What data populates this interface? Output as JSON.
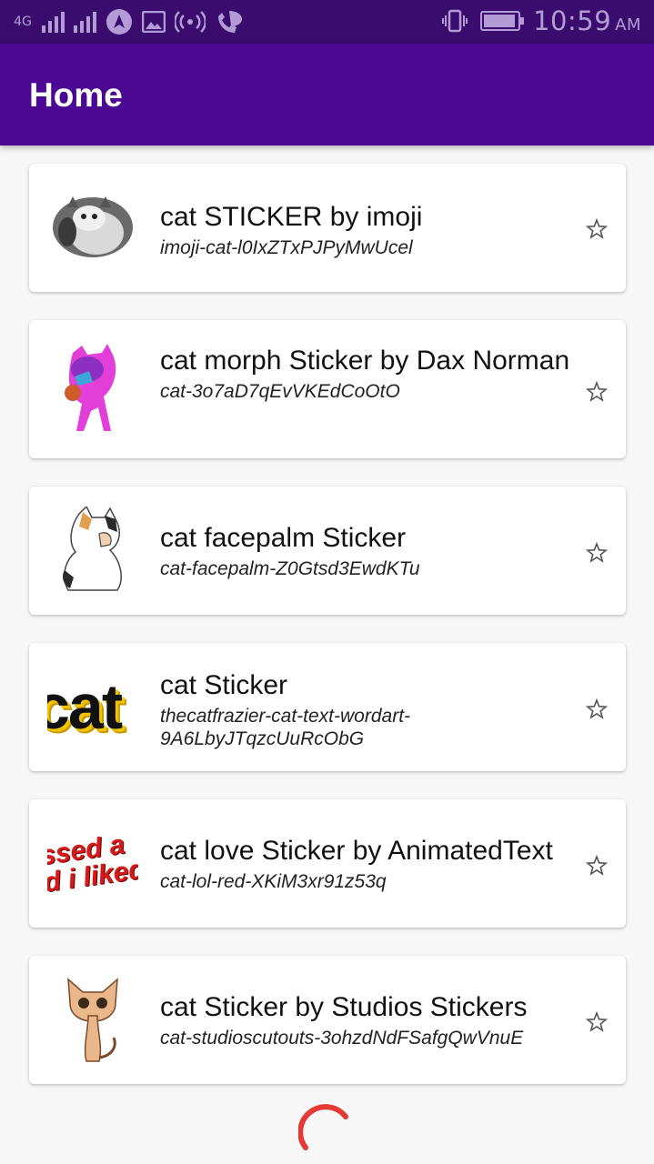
{
  "status_bar": {
    "network": "4G",
    "time": "10:59",
    "ampm": "AM",
    "icons": [
      "signal-icon",
      "signal-icon-2",
      "navigation-icon",
      "image-icon",
      "hotspot-icon",
      "wifi-calling-icon",
      "vibrate-icon",
      "battery-icon"
    ]
  },
  "app_bar": {
    "title": "Home"
  },
  "items": [
    {
      "title": "cat STICKER by imoji",
      "subtitle": "imoji-cat-l0IxZTxPJPyMwUcel",
      "thumb": "cat-sticker-thumbnail"
    },
    {
      "title": "cat morph Sticker by Dax Norman",
      "subtitle": "cat-3o7aD7qEvVKEdCoOtO",
      "thumb": "cat-morph-thumbnail"
    },
    {
      "title": "cat facepalm Sticker",
      "subtitle": "cat-facepalm-Z0Gtsd3EwdKTu",
      "thumb": "cat-facepalm-thumbnail"
    },
    {
      "title": "cat Sticker",
      "subtitle": "thecatfrazier-cat-text-wordart-9A6LbyJTqzcUuRcObG",
      "thumb": "cat-wordart-thumbnail",
      "thumb_text": "cat"
    },
    {
      "title": "cat love Sticker by AnimatedText",
      "subtitle": "cat-lol-red-XKiM3xr91z53q",
      "thumb": "cat-love-thumbnail",
      "thumb_text": "ssed a\nd i liked"
    },
    {
      "title": "cat Sticker by Studios Stickers",
      "subtitle": "cat-studioscutouts-3ohzdNdFSafgQwVnuE",
      "thumb": "cat-sphynx-thumbnail"
    }
  ],
  "colors": {
    "status_bar": "#3a0c6e",
    "app_bar": "#4b0892",
    "spinner": "#e53935"
  }
}
